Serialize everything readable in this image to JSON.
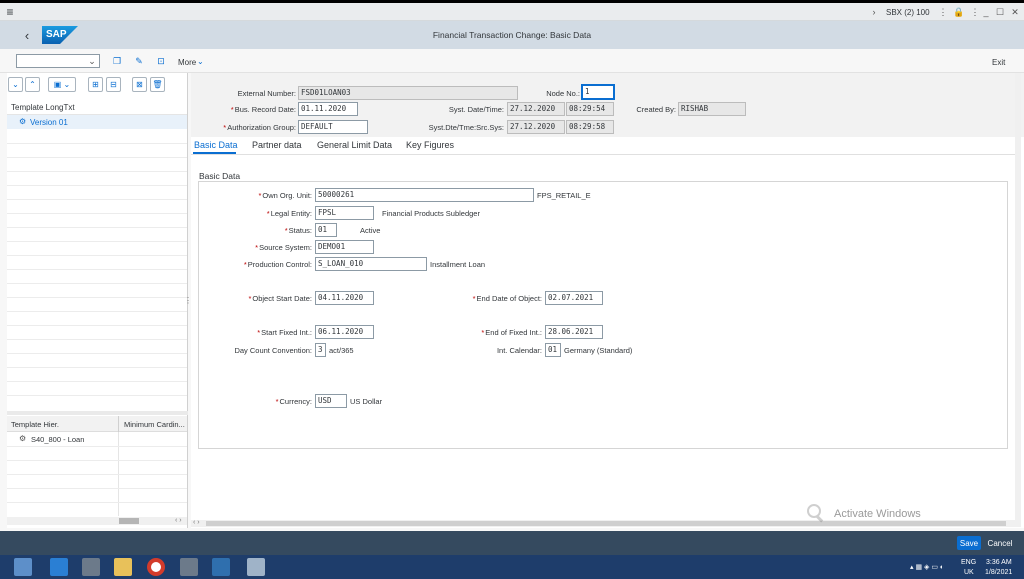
{
  "topbar": {
    "system": "SBX (2) 100"
  },
  "header": {
    "title": "Financial Transaction Change: Basic Data",
    "logo": "SAP"
  },
  "toolbar": {
    "more_label": "More",
    "exit_label": "Exit"
  },
  "left_panel": {
    "tree_header": "Template LongTxt",
    "tree_item": "Version 01",
    "hier_col1": "Template Hier.",
    "hier_col2": "Minimum Cardin...",
    "hier_item": "S40_800 - Loan"
  },
  "header_fields": {
    "external_number": {
      "label": "External Number:",
      "value": "FSD01LOAN03"
    },
    "node_no": {
      "label": "Node No.:",
      "value": "1"
    },
    "bus_record_date": {
      "label": "Bus. Record Date:",
      "value": "01.11.2020"
    },
    "syst_date_time": {
      "label": "Syst. Date/Time:",
      "date": "27.12.2020",
      "time": "08:29:54"
    },
    "created_by": {
      "label": "Created By:",
      "value": "RISHAB"
    },
    "authorization_group": {
      "label": "Authorization Group:",
      "value": "DEFAULT"
    },
    "syst_dte_src": {
      "label": "Syst.Dte/Tme:Src.Sys:",
      "date": "27.12.2020",
      "time": "08:29:58"
    }
  },
  "tabs": [
    "Basic Data",
    "Partner data",
    "General Limit Data",
    "Key Figures"
  ],
  "section_title": "Basic Data",
  "basic_data": {
    "own_org_unit": {
      "label": "Own Org. Unit:",
      "value": "50000261",
      "desc": "FPS_RETAIL_E"
    },
    "legal_entity": {
      "label": "Legal Entity:",
      "value": "FPSL",
      "desc": "Financial Products Subledger"
    },
    "status": {
      "label": "Status:",
      "value": "01",
      "desc": "Active"
    },
    "source_system": {
      "label": "Source System:",
      "value": "DEMO01"
    },
    "production_control": {
      "label": "Production Control:",
      "value": "S_LOAN_010",
      "desc": "Installment Loan"
    },
    "object_start_date": {
      "label": "Object Start Date:",
      "value": "04.11.2020"
    },
    "end_date_object": {
      "label": "End Date of Object:",
      "value": "02.07.2021"
    },
    "start_fixed_int": {
      "label": "Start Fixed Int.:",
      "value": "06.11.2020"
    },
    "end_fixed_int": {
      "label": "End of Fixed Int.:",
      "value": "28.06.2021"
    },
    "day_count": {
      "label": "Day Count Convention:",
      "value": "3",
      "desc": "act/365"
    },
    "int_calendar": {
      "label": "Int. Calendar:",
      "value": "01",
      "desc": "Germany (Standard)"
    },
    "currency": {
      "label": "Currency:",
      "value": "USD",
      "desc": "US Dollar"
    }
  },
  "footer": {
    "save_label": "Save",
    "cancel_label": "Cancel"
  },
  "watermark": {
    "line1": "Activate Windows"
  },
  "taskbar": {
    "lang": "ENG",
    "region": "UK",
    "time": "3:36 AM",
    "date": "1/8/2021"
  },
  "colors": {
    "accent": "#0a6ed1",
    "footer": "#354a5f",
    "titlebar": "#d2dbe4",
    "required": "#bb0000"
  }
}
